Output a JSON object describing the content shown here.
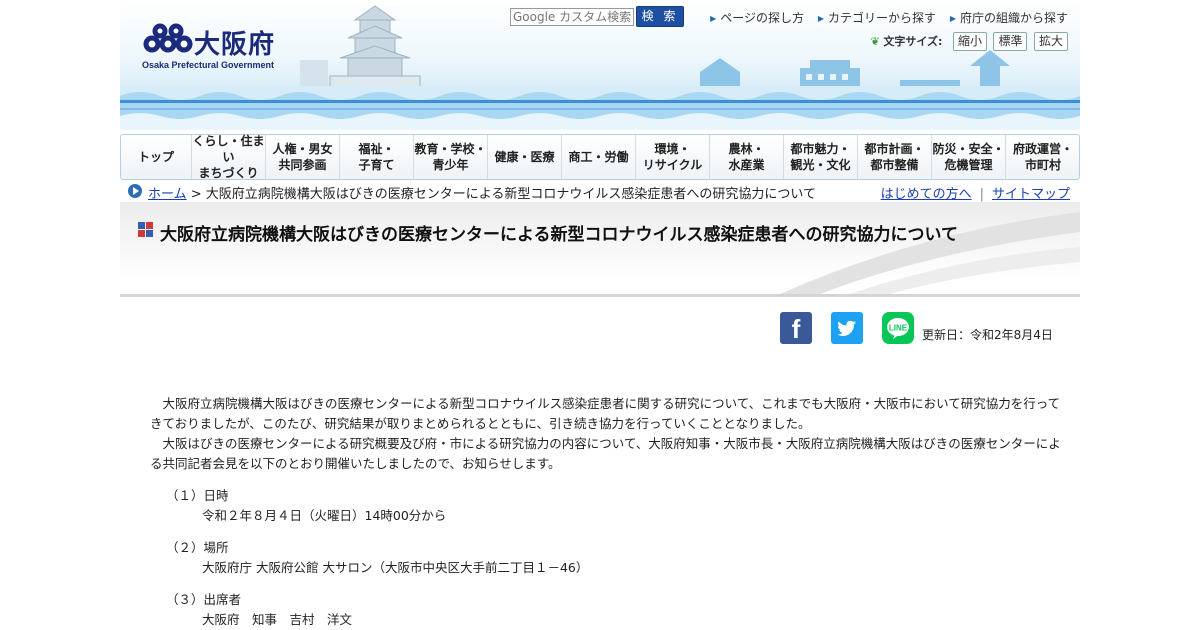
{
  "header": {
    "logo_text": "大阪府",
    "logo_subtext": "Osaka Prefectural Government",
    "search_placeholder": "Google カスタム検索",
    "search_button": "検 索",
    "top_links": [
      "ページの探し方",
      "カテゴリーから探す",
      "府庁の組織から探す"
    ],
    "font_size_label": "文字サイズ:",
    "font_size_options": [
      "縮小",
      "標準",
      "拡大"
    ]
  },
  "gnav": [
    {
      "line1": "トップ",
      "line2": ""
    },
    {
      "line1": "くらし・住まい",
      "line2": "まちづくり"
    },
    {
      "line1": "人権・男女",
      "line2": "共同参画"
    },
    {
      "line1": "福祉・",
      "line2": "子育て"
    },
    {
      "line1": "教育・学校・",
      "line2": "青少年"
    },
    {
      "line1": "健康・医療",
      "line2": ""
    },
    {
      "line1": "商工・労働",
      "line2": ""
    },
    {
      "line1": "環境・",
      "line2": "リサイクル"
    },
    {
      "line1": "農林・",
      "line2": "水産業"
    },
    {
      "line1": "都市魅力・",
      "line2": "観光・文化"
    },
    {
      "line1": "都市計画・",
      "line2": "都市整備"
    },
    {
      "line1": "防災・安全・",
      "line2": "危機管理"
    },
    {
      "line1": "府政運営・",
      "line2": "市町村"
    }
  ],
  "breadcrumb": {
    "home": "ホーム",
    "current": " > 大阪府立病院機構大阪はびきの医療センターによる新型コロナウイルス感染症患者への研究協力について",
    "first_time": "はじめての方へ",
    "sitemap": "サイトマップ"
  },
  "page": {
    "title": "大阪府立病院機構大阪はびきの医療センターによる新型コロナウイルス感染症患者への研究協力について",
    "updated": "更新日：令和2年8月4日",
    "paragraphs": [
      "大阪府立病院機構大阪はびきの医療センターによる新型コロナウイルス感染症患者に関する研究について、これまでも大阪府・大阪市において研究協力を行ってきておりましたが、このたび、研究結果が取りまとめられるとともに、引き続き協力を行っていくこととなりました。",
      "大阪はびきの医療センターによる研究概要及び府・市による研究協力の内容について、大阪府知事・大阪市長・大阪府立病院機構大阪はびきの医療センターによる共同記者会見を以下のとおり開催いたしましたので、お知らせします。"
    ],
    "items": [
      {
        "head": "（１）日時",
        "body": "令和２年８月４日（火曜日）14時00分から"
      },
      {
        "head": "（２）場所",
        "body": "大阪府庁 大阪府公館 大サロン（大阪市中央区大手前二丁目１－46）"
      },
      {
        "head": "（３）出席者",
        "body": "大阪府　知事　吉村　洋文"
      }
    ]
  },
  "colors": {
    "brand_navy": "#1b2a7a",
    "link_blue": "#1a3fb0",
    "facebook": "#3b5998",
    "twitter": "#1da1f2",
    "line": "#06c755"
  },
  "icons": [
    "logo-mark-icon",
    "castle-icon",
    "skyline-icon",
    "breadcrumb-arrow-icon",
    "title-squares-icon",
    "facebook-icon",
    "twitter-icon",
    "line-icon",
    "leaf-icon"
  ]
}
